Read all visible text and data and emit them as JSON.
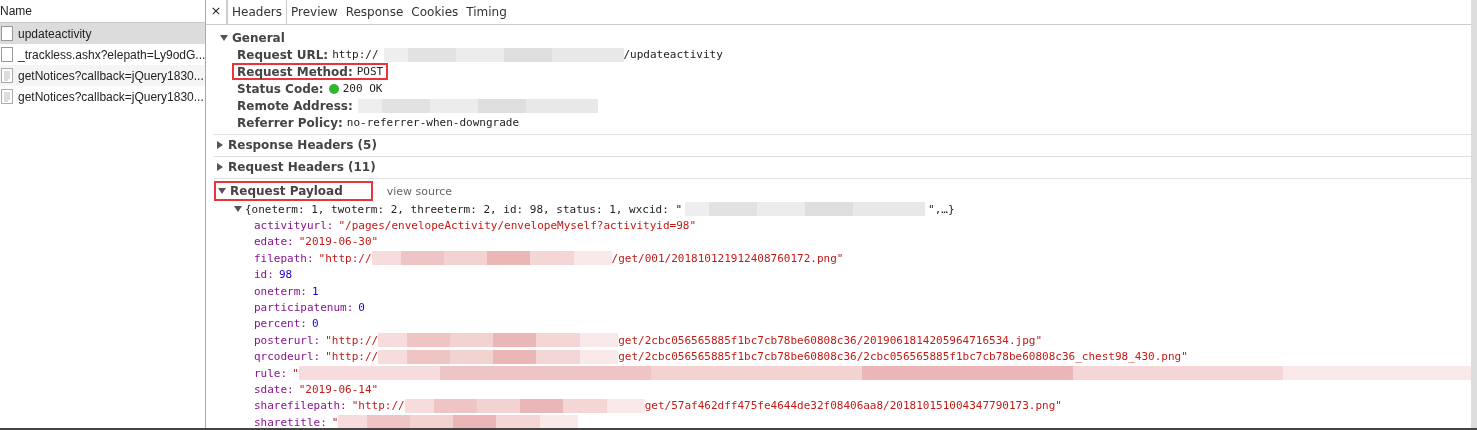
{
  "requests": {
    "header": "Name",
    "items": [
      {
        "name": "updateactivity",
        "kind": "blank",
        "selected": true
      },
      {
        "name": "_trackless.ashx?elepath=Ly9odG...",
        "kind": "blank",
        "selected": false
      },
      {
        "name": "getNotices?callback=jQuery1830...",
        "kind": "script",
        "selected": false
      },
      {
        "name": "getNotices?callback=jQuery1830...",
        "kind": "script",
        "selected": false
      }
    ]
  },
  "close": "×",
  "tabs": [
    {
      "label": "Headers",
      "selected": true
    },
    {
      "label": "Preview",
      "selected": false
    },
    {
      "label": "Response",
      "selected": false
    },
    {
      "label": "Cookies",
      "selected": false
    },
    {
      "label": "Timing",
      "selected": false
    }
  ],
  "general": {
    "title": "General",
    "expanded": true,
    "rows": [
      {
        "label": "Request URL:",
        "before": "http://",
        "redacted": true,
        "after": "/updateactivity",
        "highlighted": false
      },
      {
        "label": "Request Method:",
        "before": "POST",
        "highlighted": true
      },
      {
        "label": "Status Code:",
        "before": "200 OK",
        "status_ok": true,
        "highlighted": false
      },
      {
        "label": "Remote Address:",
        "redacted": true,
        "highlighted": false
      },
      {
        "label": "Referrer Policy:",
        "before": "no-referrer-when-downgrade",
        "highlighted": false
      }
    ]
  },
  "sections": [
    {
      "title": "Response Headers (5)",
      "expanded": false
    },
    {
      "title": "Request Headers (11)",
      "expanded": false
    }
  ],
  "payload": {
    "title": "Request Payload",
    "expanded": true,
    "highlighted": true,
    "link": "view source",
    "summary_before": "{oneterm: 1, twoterm: 2, threeterm: 2, id: 98, status: 1, wxcid: \"",
    "summary_after": "\",…}",
    "entries": [
      {
        "key": "activityurl:",
        "kind": "string",
        "before": "\"/pages/envelopeActivity/envelopeMyself?activityid=98\""
      },
      {
        "key": "edate:",
        "kind": "string",
        "before": "\"2019-06-30\""
      },
      {
        "key": "filepath:",
        "kind": "string",
        "before": "\"http://",
        "redacted": true,
        "after": "/get/001/201810121912408760172.png\""
      },
      {
        "key": "id:",
        "kind": "number",
        "before": "98"
      },
      {
        "key": "oneterm:",
        "kind": "number",
        "before": "1"
      },
      {
        "key": "participatenum:",
        "kind": "number",
        "before": "0"
      },
      {
        "key": "percent:",
        "kind": "number",
        "before": "0"
      },
      {
        "key": "posterurl:",
        "kind": "string",
        "before": "\"http://",
        "redacted": true,
        "after": "get/2cbc056565885f1bc7cb78be60808c36/2019061814205964716534.jpg\""
      },
      {
        "key": "qrcodeurl:",
        "kind": "string",
        "before": "\"http://",
        "redacted": true,
        "after": "get/2cbc056565885f1bc7cb78be60808c36/2cbc056565885f1bc7cb78be60808c36_chest98_430.png\""
      },
      {
        "key": "rule:",
        "kind": "string",
        "before": "\"",
        "redacted": true,
        "redacted_to_end": true
      },
      {
        "key": "sdate:",
        "kind": "string",
        "before": "\"2019-06-14\""
      },
      {
        "key": "sharefilepath:",
        "kind": "string",
        "before": "\"http://",
        "redacted": true,
        "after": "get/57af462dff475fe4644de32f08406aa8/201810151004347790173.png\""
      },
      {
        "key": "sharetitle:",
        "kind": "string",
        "before": "\"",
        "redacted": true
      }
    ]
  }
}
